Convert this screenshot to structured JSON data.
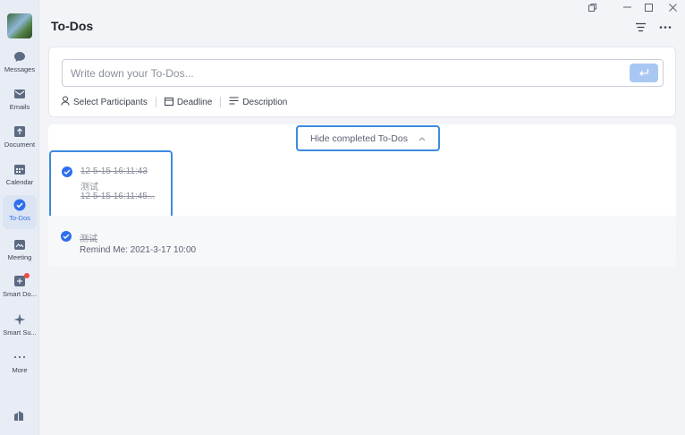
{
  "sidebar": {
    "items": [
      {
        "label": "Messages",
        "icon": "chat-bubble-icon"
      },
      {
        "label": "Emails",
        "icon": "mail-icon"
      },
      {
        "label": "Document",
        "icon": "document-icon"
      },
      {
        "label": "Calendar",
        "icon": "calendar-icon"
      },
      {
        "label": "To-Dos",
        "icon": "todo-check-icon",
        "active": true
      },
      {
        "label": "Meeting",
        "icon": "meeting-icon"
      },
      {
        "label": "Smart Do...",
        "icon": "smart-doc-icon",
        "badge": true
      },
      {
        "label": "Smart Su...",
        "icon": "sparkle-icon"
      },
      {
        "label": "More",
        "icon": "more-dots-icon"
      }
    ],
    "bottom_icon": "app-store-icon"
  },
  "header": {
    "title": "To-Dos"
  },
  "input": {
    "placeholder": "Write down your To-Dos...",
    "value": ""
  },
  "options": {
    "participants": "Select Participants",
    "deadline": "Deadline",
    "description": "Description"
  },
  "list": {
    "hide_completed_label": "Hide completed To-Dos",
    "todos": [
      {
        "title": "12 5-15 16:11:43",
        "subtitle": "测试",
        "detail": "12 5-15 16:11:45...",
        "completed": true
      },
      {
        "title": "测试",
        "reminder": "Remind Me: 2021-3-17 10:00",
        "completed": true
      }
    ]
  },
  "colors": {
    "accent": "#2f6fed",
    "highlight_border": "#3d8be0",
    "send_button": "#a9c7f3",
    "badge": "#f54a45"
  }
}
